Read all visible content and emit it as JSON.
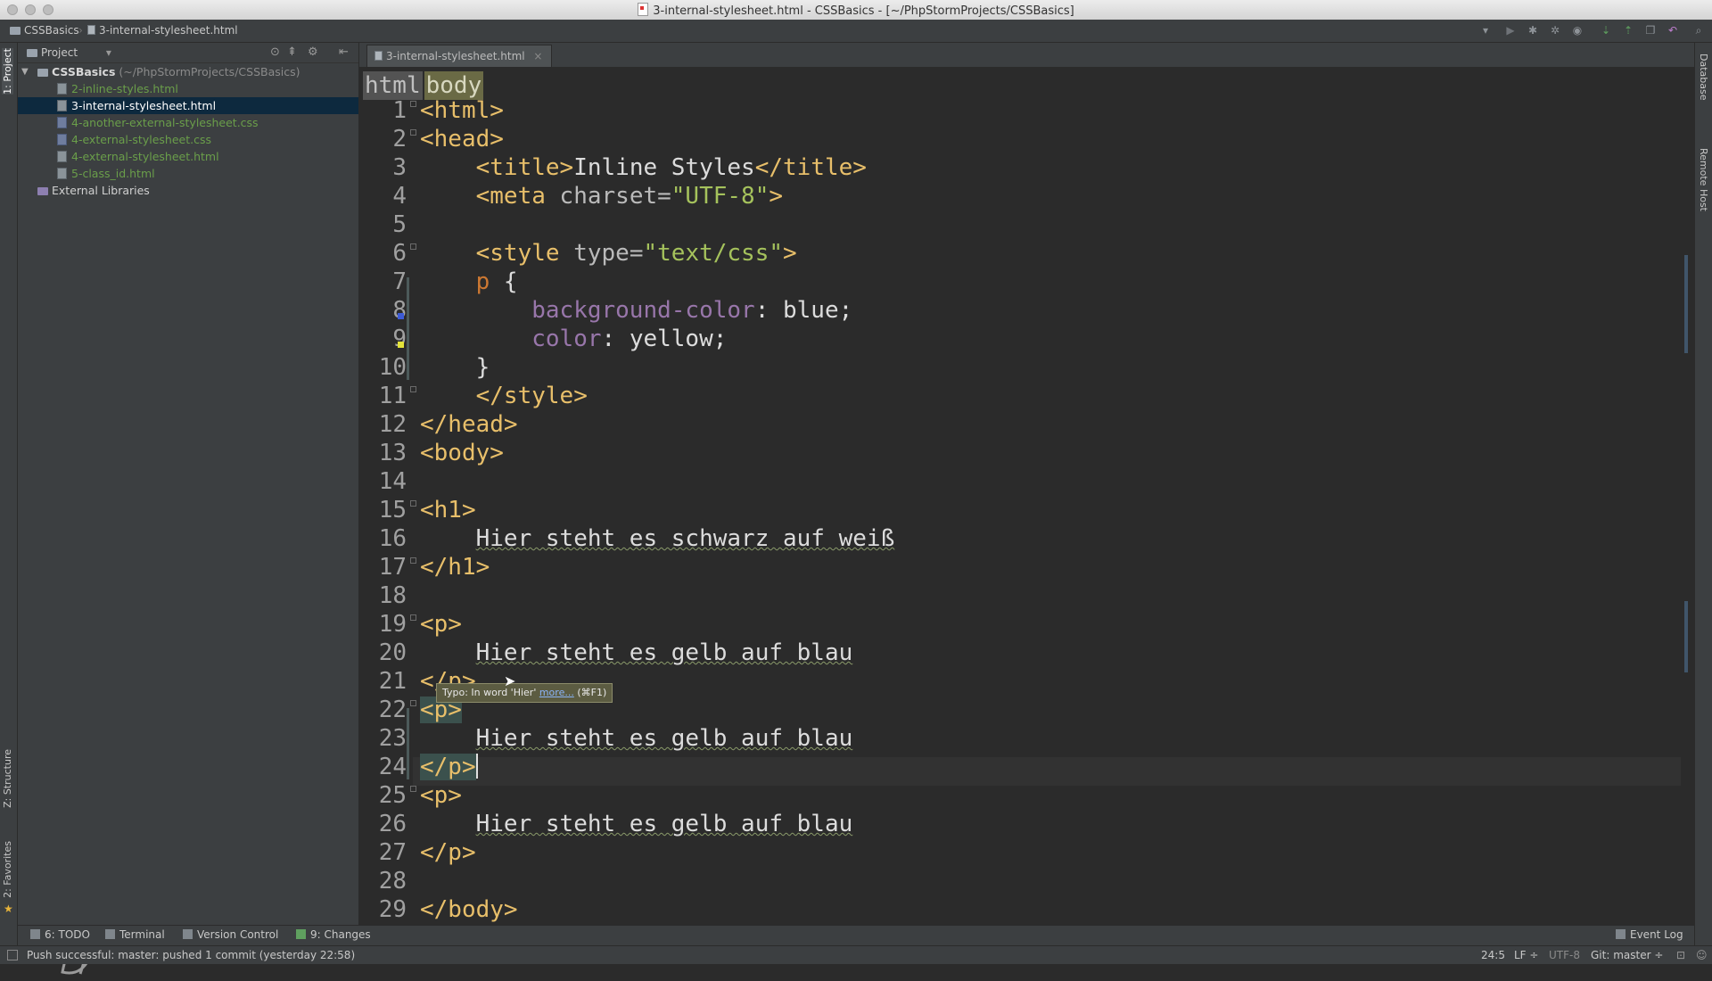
{
  "window": {
    "title": "3-internal-stylesheet.html - CSSBasics - [~/PhpStormProjects/CSSBasics]"
  },
  "navbar": {
    "project": "CSSBasics",
    "file": "3-internal-stylesheet.html"
  },
  "left_stripe": {
    "project_tab": "1: Project",
    "structure_tab": "Z: Structure",
    "favorites_tab": "2: Favorites"
  },
  "right_stripe": {
    "database_tab": "Database",
    "remote_host_tab": "Remote Host"
  },
  "project_panel": {
    "header": "Project",
    "root": {
      "name": "CSSBasics",
      "path": "(~/PhpStormProjects/CSSBasics)"
    },
    "files": [
      {
        "name": "2-inline-styles.html",
        "type": "html",
        "selected": false
      },
      {
        "name": "3-internal-stylesheet.html",
        "type": "html",
        "selected": true
      },
      {
        "name": "4-another-external-stylesheet.css",
        "type": "css",
        "selected": false
      },
      {
        "name": "4-external-stylesheet.css",
        "type": "css",
        "selected": false
      },
      {
        "name": "4-external-stylesheet.html",
        "type": "html",
        "selected": false
      },
      {
        "name": "5-class_id.html",
        "type": "html",
        "selected": false
      }
    ],
    "external": "External Libraries"
  },
  "editor": {
    "tab": "3-internal-stylesheet.html",
    "breadcrumbs": [
      "html",
      "body"
    ],
    "line_numbers": [
      "1",
      "2",
      "3",
      "4",
      "5",
      "6",
      "7",
      "8",
      "9",
      "10",
      "11",
      "12",
      "13",
      "14",
      "15",
      "16",
      "17",
      "18",
      "19",
      "20",
      "21",
      "22",
      "23",
      "24",
      "25",
      "26",
      "27",
      "28",
      "29"
    ],
    "lines": {
      "l1": "<html>",
      "l2": "<head>",
      "l3_open": "<title>",
      "l3_text": "Inline Styles",
      "l3_close": "</title>",
      "l4_tag": "<meta ",
      "l4_attr": "charset=",
      "l4_val": "\"UTF-8\"",
      "l4_end": ">",
      "l6_tag": "<style ",
      "l6_attr": "type=",
      "l6_val": "\"text/css\"",
      "l6_end": ">",
      "l7_sel": "p",
      "l7_brace": " {",
      "l8_prop": "background-color",
      "l8_val": ": blue;",
      "l9_prop": "color",
      "l9_val": ": yellow;",
      "l10": "}",
      "l11": "</style>",
      "l12": "</head>",
      "l13": "<body>",
      "l15": "<h1>",
      "l16": "Hier steht es schwarz auf weiß",
      "l17": "</h1>",
      "l19": "<p>",
      "l20": "Hier steht es gelb auf blau",
      "l21": "</p>",
      "l22": "<p>",
      "l23": "Hier steht es gelb auf blau",
      "l24": "</p>",
      "l25": "<p>",
      "l26": "Hier steht es gelb auf blau",
      "l27": "</p>",
      "l29": "</body>"
    },
    "tooltip": {
      "text": "Typo: In word 'Hier'",
      "link": "more...",
      "shortcut": "(⌘F1)"
    }
  },
  "tool_windows": {
    "todo": "6: TODO",
    "terminal": "Terminal",
    "vcs": "Version Control",
    "changes": "9: Changes",
    "event_log": "Event Log"
  },
  "status": {
    "message": "Push successful: master: pushed 1 commit (yesterday 22:58)",
    "position": "24:5",
    "line_sep": "LF ÷",
    "encoding": "UTF-8",
    "git": "Git: master ÷"
  },
  "colors": {
    "tag": "#e8bf6a",
    "css_selector": "#cc7832",
    "css_property": "#9876aa",
    "string": "#a5c25c",
    "background": "#2b2b2b",
    "panel": "#3c3f41",
    "selection": "#0d293e"
  }
}
